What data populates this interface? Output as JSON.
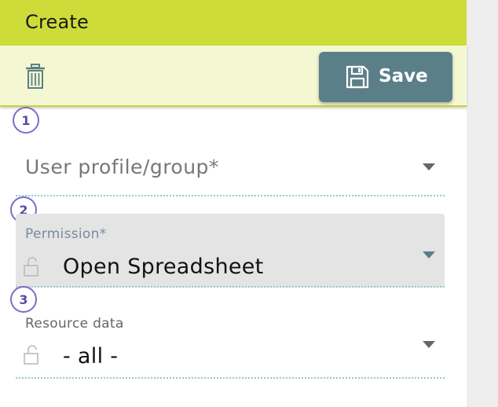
{
  "header": {
    "title": "Create"
  },
  "toolbar": {
    "delete_icon": "trash-icon",
    "save_label": "Save",
    "save_icon": "floppy-disk-icon"
  },
  "steps": [
    "1",
    "2",
    "3"
  ],
  "fields": {
    "profile": {
      "placeholder": "User profile/group*"
    },
    "permission": {
      "label": "Permission*",
      "value": "Open Spreadsheet",
      "icon": "unlock-icon"
    },
    "resource": {
      "label": "Resource data",
      "value": "- all -",
      "icon": "unlock-icon"
    }
  },
  "colors": {
    "header_bg": "#cddc39",
    "toolbar_bg": "#f4f8d2",
    "save_button_bg": "#5b7f88",
    "step_badge_border": "#7e6bc4",
    "field_underline": "#9cc6d4"
  }
}
